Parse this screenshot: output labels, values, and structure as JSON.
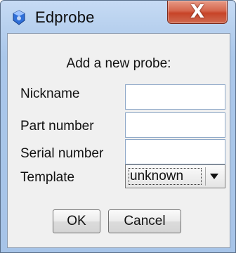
{
  "window": {
    "title": "Edprobe",
    "close_label": "X",
    "app_icon": "edprobe-app-icon"
  },
  "dialog": {
    "heading": "Add a new probe:",
    "fields": {
      "nickname": {
        "label": "Nickname",
        "value": ""
      },
      "part_number": {
        "label": "Part number",
        "value": ""
      },
      "serial_number": {
        "label": "Serial number",
        "value": ""
      }
    },
    "template": {
      "label": "Template",
      "selected": "unknown"
    },
    "buttons": {
      "ok": "OK",
      "cancel": "Cancel"
    }
  }
}
